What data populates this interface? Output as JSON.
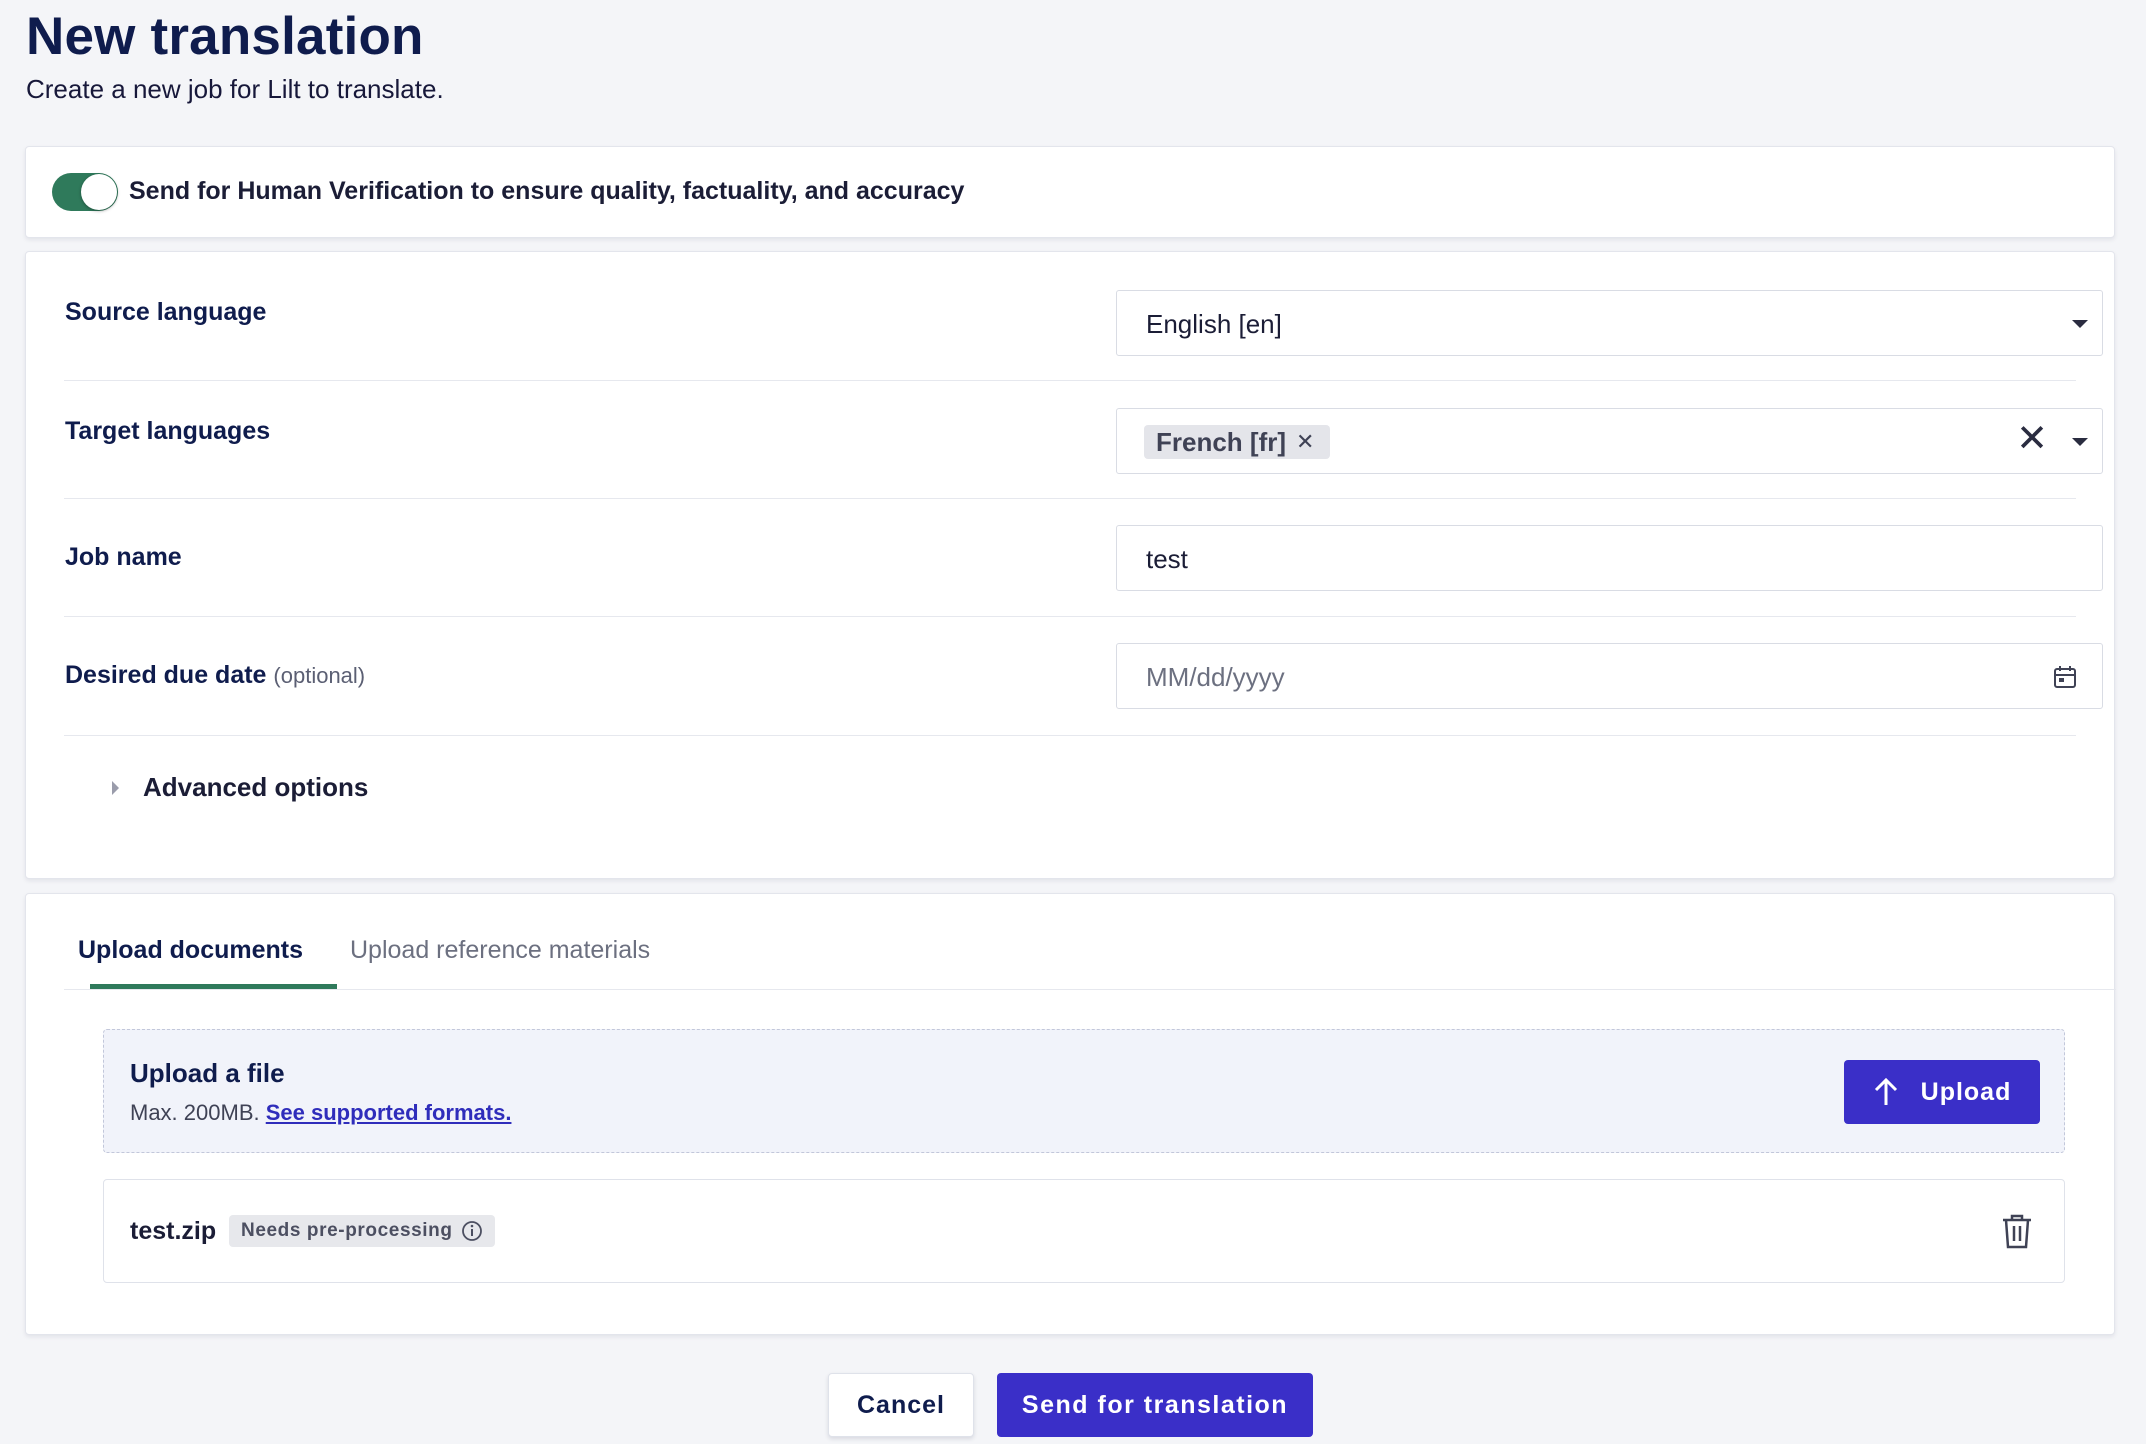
{
  "header": {
    "title": "New translation",
    "subtitle": "Create a new job for Lilt to translate."
  },
  "verification": {
    "enabled": true,
    "label": "Send for Human Verification to ensure quality, factuality, and accuracy"
  },
  "form": {
    "source_language": {
      "label": "Source language",
      "value": "English [en]"
    },
    "target_languages": {
      "label": "Target languages",
      "selected": [
        "French [fr]"
      ]
    },
    "job_name": {
      "label": "Job name",
      "value": "test"
    },
    "due_date": {
      "label": "Desired due date",
      "optional": "(optional)",
      "placeholder": "MM/dd/yyyy"
    },
    "advanced_options": {
      "label": "Advanced options",
      "expanded": false
    }
  },
  "upload": {
    "tabs": [
      {
        "label": "Upload documents",
        "active": true
      },
      {
        "label": "Upload reference materials",
        "active": false
      }
    ],
    "dropzone": {
      "title": "Upload a file",
      "max_size": "Max. 200MB.",
      "formats_link": "See supported formats.",
      "button_label": "Upload"
    },
    "files": [
      {
        "name": "test.zip",
        "badge": "Needs pre-processing"
      }
    ]
  },
  "actions": {
    "cancel_label": "Cancel",
    "send_label": "Send for translation"
  },
  "colors": {
    "primary": "#3a2fc8",
    "toggle_on": "#2f7a5b",
    "heading": "#0f1c4d"
  }
}
